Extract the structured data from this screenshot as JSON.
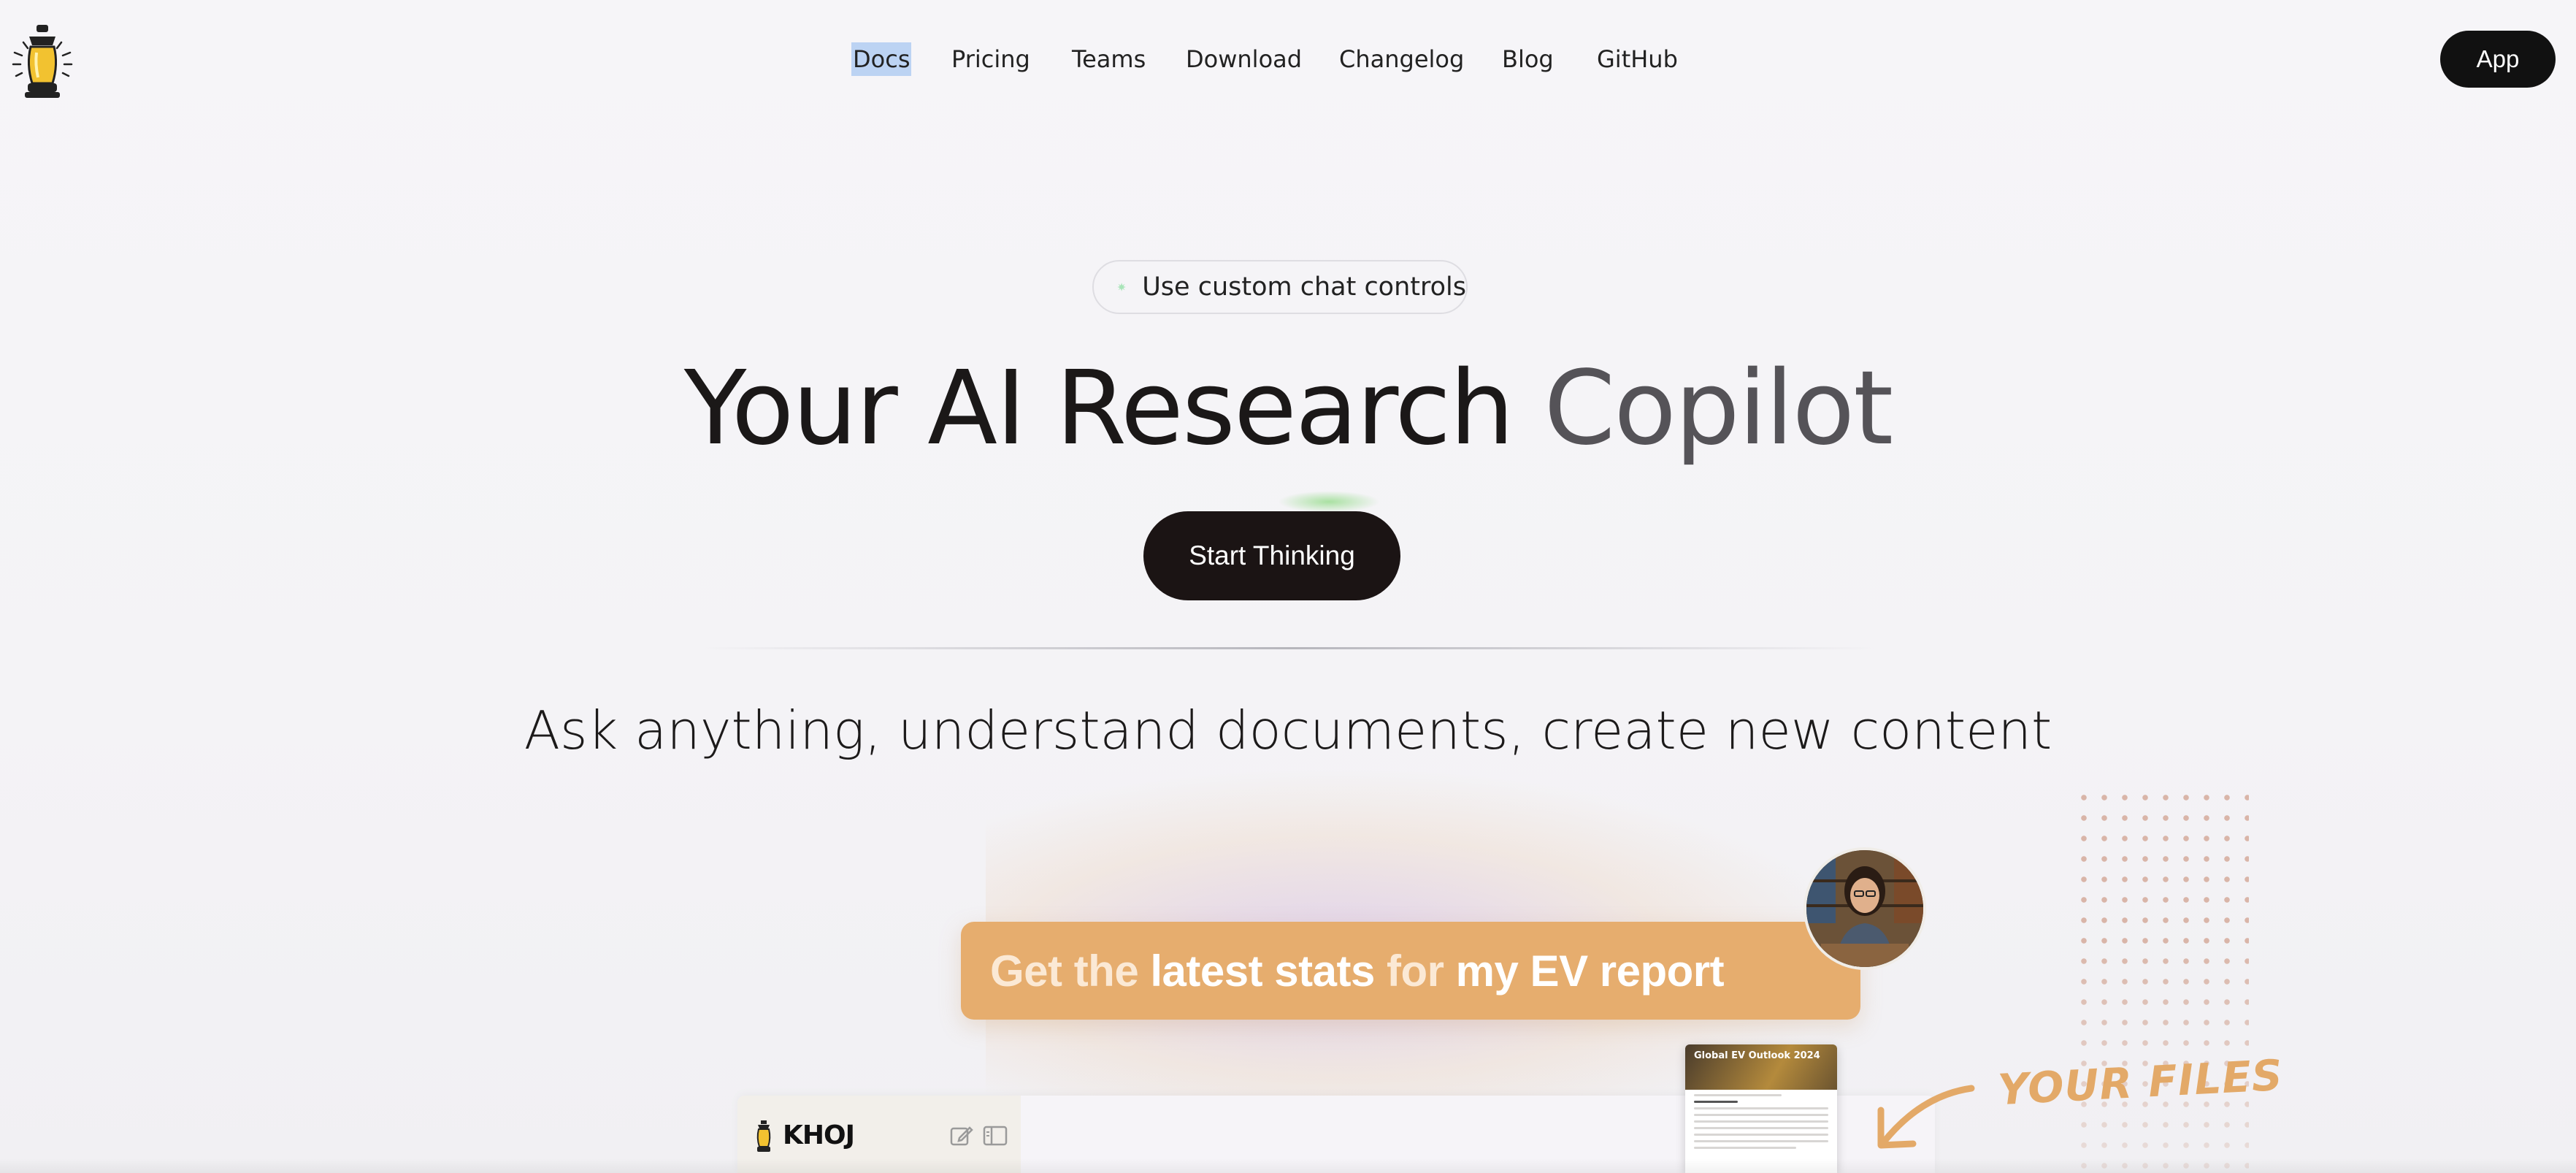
{
  "nav": {
    "items": [
      "Docs",
      "Pricing",
      "Teams",
      "Download",
      "Changelog",
      "Blog",
      "GitHub"
    ],
    "selected": "Docs",
    "app_button": "App"
  },
  "hero": {
    "badge": "Use custom chat controls",
    "title_dark": "Your AI Research",
    "title_light": "Copilot",
    "cta": "Start Thinking",
    "subtitle": "Ask anything, understand documents, create new content"
  },
  "demo": {
    "prompt_parts": [
      {
        "text": "Get the ",
        "style": "soft"
      },
      {
        "text": "latest stats",
        "style": "bold"
      },
      {
        "text": " for ",
        "style": "soft"
      },
      {
        "text": "my EV report",
        "style": "bold"
      }
    ],
    "brand": "KHOJ",
    "doc_title": "Global EV Outlook 2024",
    "files_label": "YOUR FILES"
  },
  "colors": {
    "accent_orange": "#e6ad6e",
    "cta_bg": "#1b1414",
    "nav_selected": "#bcd3f3"
  },
  "icons": [
    "lantern-logo-icon",
    "sparkle-icon",
    "edit-icon",
    "sidebar-icon",
    "arrow-icon"
  ]
}
